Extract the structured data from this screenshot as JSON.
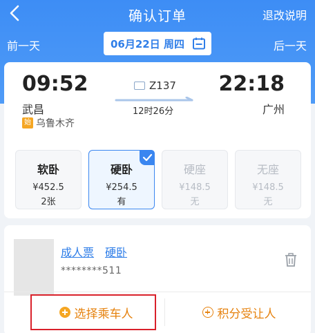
{
  "nav": {
    "title": "确认订单",
    "right_link": "退改说明"
  },
  "datebar": {
    "prev": "前一天",
    "next": "后一天",
    "date": "06月22日 周四"
  },
  "trip": {
    "dep_time": "09:52",
    "arr_time": "22:18",
    "dep_station": "武昌",
    "arr_station": "广州",
    "terminus_badge": "始",
    "terminus": "乌鲁木齐",
    "train_no": "Z137",
    "duration": "12时26分"
  },
  "seats": [
    {
      "name": "软卧",
      "price": "¥452.5",
      "count": "2张",
      "state": "available"
    },
    {
      "name": "硬卧",
      "price": "¥254.5",
      "count": "有",
      "state": "selected"
    },
    {
      "name": "硬座",
      "price": "¥148.5",
      "count": "无",
      "state": "disabled"
    },
    {
      "name": "无座",
      "price": "¥148.5",
      "count": "无",
      "state": "disabled"
    }
  ],
  "passenger": {
    "ticket_type": "成人票",
    "seat_type": "硬卧",
    "id_masked": "********511"
  },
  "actions": {
    "select_passenger": "选择乘车人",
    "points_transfer": "积分受让人"
  },
  "colors": {
    "brand_blue": "#3d8df5",
    "accent_orange": "#e6820e",
    "highlight_red": "#d9202a"
  }
}
